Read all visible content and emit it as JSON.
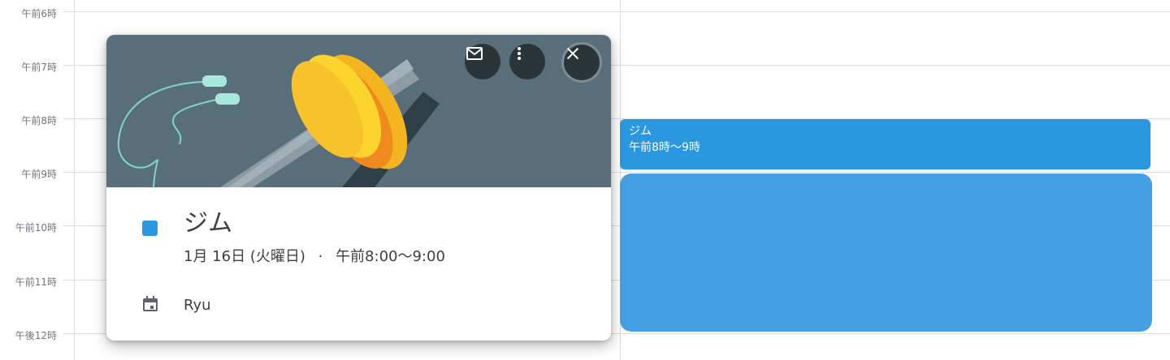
{
  "time_labels": [
    "午前6時",
    "午前7時",
    "午前8時",
    "午前9時",
    "午前10時",
    "午前11時",
    "午後12時"
  ],
  "event": {
    "title": "ジム",
    "time": "午前8時〜9時",
    "color": "#2a98e0"
  },
  "popup": {
    "title": "ジム",
    "date": "1月 16日 (火曜日)",
    "separator": "·",
    "time": "午前8:00〜9:00",
    "calendar_name": "Ryu",
    "buttons": {
      "email_icon": "email-icon",
      "more_icon": "more-vert-icon",
      "close_icon": "close-icon"
    },
    "colors": {
      "banner": "#586e7a",
      "swatch": "#2a98e0"
    }
  }
}
